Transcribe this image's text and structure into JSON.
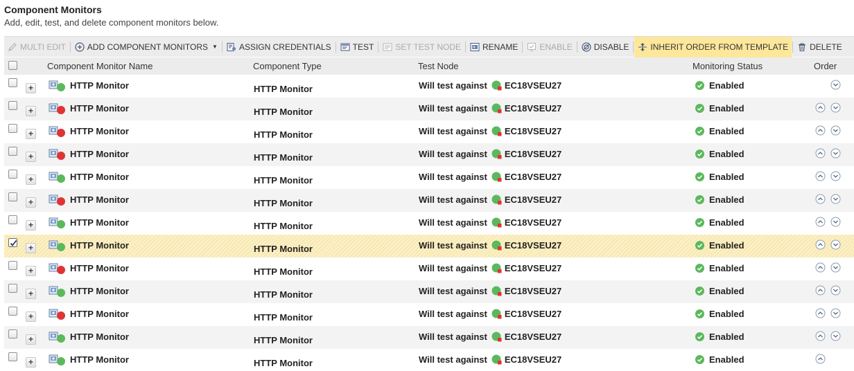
{
  "header": {
    "title": "Component Monitors",
    "subtitle": "Add, edit, test, and delete component monitors below."
  },
  "toolbar": {
    "multi_edit": "MULTI EDIT",
    "add_component_monitors": "ADD COMPONENT MONITORS",
    "assign_credentials": "ASSIGN CREDENTIALS",
    "test": "TEST",
    "set_test_node": "SET TEST NODE",
    "rename": "RENAME",
    "enable": "ENABLE",
    "disable": "DISABLE",
    "inherit_order": "INHERIT ORDER FROM TEMPLATE",
    "delete": "DELETE"
  },
  "columns": {
    "name": "Component Monitor Name",
    "type": "Component Type",
    "test_node": "Test Node",
    "status": "Monitoring Status",
    "order": "Order"
  },
  "colors": {
    "status_green": "#5cb85c",
    "status_red": "#e03333",
    "selected_row": "#fbf0c6",
    "highlight_button": "#fce79b"
  },
  "rows": [
    {
      "name": "HTTP Monitor",
      "type": "HTTP Monitor",
      "test_prefix": "Will test against",
      "node": "EC18VSEU27",
      "status": "Enabled",
      "monitor_state": "up",
      "checked": false,
      "up_arrow": false,
      "down_arrow": true
    },
    {
      "name": "HTTP Monitor",
      "type": "HTTP Monitor",
      "test_prefix": "Will test against",
      "node": "EC18VSEU27",
      "status": "Enabled",
      "monitor_state": "down",
      "checked": false,
      "up_arrow": true,
      "down_arrow": true
    },
    {
      "name": "HTTP Monitor",
      "type": "HTTP Monitor",
      "test_prefix": "Will test against",
      "node": "EC18VSEU27",
      "status": "Enabled",
      "monitor_state": "down",
      "checked": false,
      "up_arrow": true,
      "down_arrow": true
    },
    {
      "name": "HTTP Monitor",
      "type": "HTTP Monitor",
      "test_prefix": "Will test against",
      "node": "EC18VSEU27",
      "status": "Enabled",
      "monitor_state": "down",
      "checked": false,
      "up_arrow": true,
      "down_arrow": true
    },
    {
      "name": "HTTP Monitor",
      "type": "HTTP Monitor",
      "test_prefix": "Will test against",
      "node": "EC18VSEU27",
      "status": "Enabled",
      "monitor_state": "up",
      "checked": false,
      "up_arrow": true,
      "down_arrow": true
    },
    {
      "name": "HTTP Monitor",
      "type": "HTTP Monitor",
      "test_prefix": "Will test against",
      "node": "EC18VSEU27",
      "status": "Enabled",
      "monitor_state": "down",
      "checked": false,
      "up_arrow": true,
      "down_arrow": true
    },
    {
      "name": "HTTP Monitor",
      "type": "HTTP Monitor",
      "test_prefix": "Will test against",
      "node": "EC18VSEU27",
      "status": "Enabled",
      "monitor_state": "up",
      "checked": false,
      "up_arrow": true,
      "down_arrow": true
    },
    {
      "name": "HTTP Monitor",
      "type": "HTTP Monitor",
      "test_prefix": "Will test against",
      "node": "EC18VSEU27",
      "status": "Enabled",
      "monitor_state": "up",
      "checked": true,
      "up_arrow": true,
      "down_arrow": true
    },
    {
      "name": "HTTP Monitor",
      "type": "HTTP Monitor",
      "test_prefix": "Will test against",
      "node": "EC18VSEU27",
      "status": "Enabled",
      "monitor_state": "down",
      "checked": false,
      "up_arrow": true,
      "down_arrow": true
    },
    {
      "name": "HTTP Monitor",
      "type": "HTTP Monitor",
      "test_prefix": "Will test against",
      "node": "EC18VSEU27",
      "status": "Enabled",
      "monitor_state": "up",
      "checked": false,
      "up_arrow": true,
      "down_arrow": true
    },
    {
      "name": "HTTP Monitor",
      "type": "HTTP Monitor",
      "test_prefix": "Will test against",
      "node": "EC18VSEU27",
      "status": "Enabled",
      "monitor_state": "down",
      "checked": false,
      "up_arrow": true,
      "down_arrow": true
    },
    {
      "name": "HTTP Monitor",
      "type": "HTTP Monitor",
      "test_prefix": "Will test against",
      "node": "EC18VSEU27",
      "status": "Enabled",
      "monitor_state": "up",
      "checked": false,
      "up_arrow": true,
      "down_arrow": true
    },
    {
      "name": "HTTP Monitor",
      "type": "HTTP Monitor",
      "test_prefix": "Will test against",
      "node": "EC18VSEU27",
      "status": "Enabled",
      "monitor_state": "up",
      "checked": false,
      "up_arrow": true,
      "down_arrow": false
    }
  ]
}
